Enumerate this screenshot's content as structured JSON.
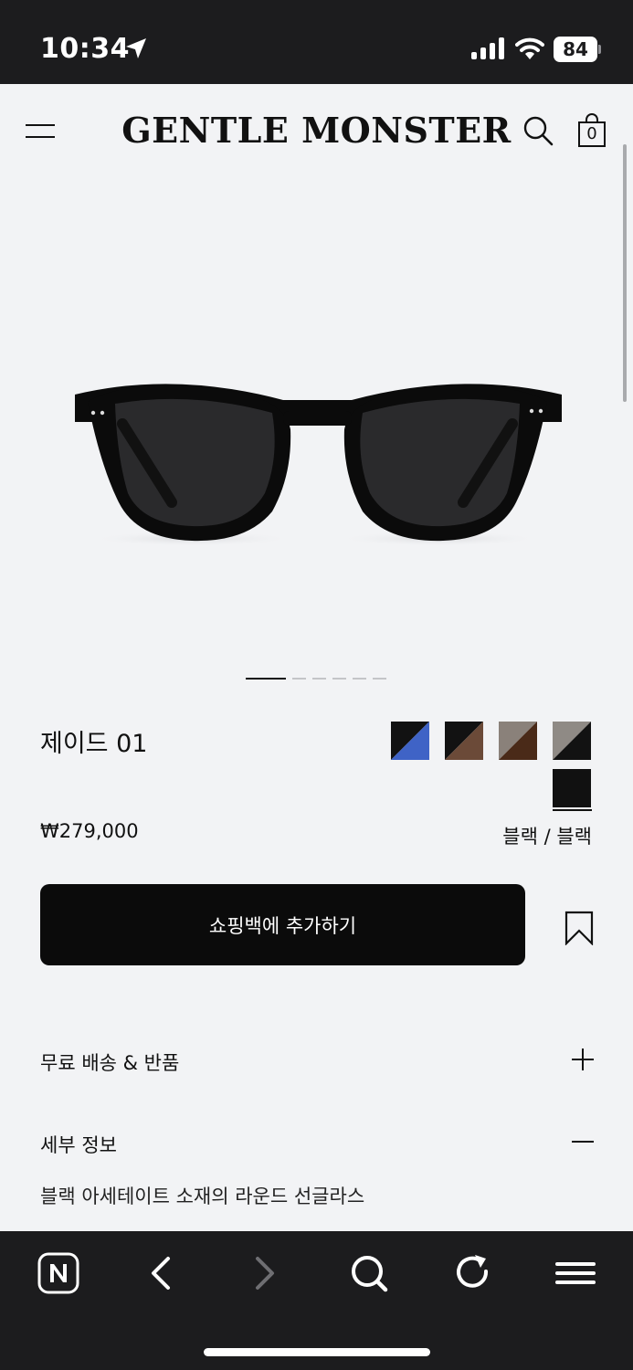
{
  "status_bar": {
    "time": "10:34",
    "battery": "84"
  },
  "header": {
    "brand": "GENTLE MONSTER",
    "bag_count": "0"
  },
  "product": {
    "name": "제이드 01",
    "price": "₩279,000",
    "selected_color": "블랙 / 블랙",
    "carousel": {
      "total": 6,
      "active": 1
    },
    "swatches": [
      {
        "name": "black-blue",
        "colors": [
          "#121212",
          "#3f63c6"
        ]
      },
      {
        "name": "black-brown",
        "colors": [
          "#121212",
          "#6b4a38"
        ]
      },
      {
        "name": "grey-brown",
        "colors": [
          "#8a817a",
          "#4a2a18"
        ]
      },
      {
        "name": "grey-black",
        "colors": [
          "#8f8a85",
          "#121212"
        ]
      },
      {
        "name": "black-black",
        "colors": [
          "#111111",
          "#111111"
        ],
        "selected": true
      }
    ]
  },
  "actions": {
    "add_to_bag": "쇼핑백에 추가하기"
  },
  "accordion": {
    "shipping_label": "무료 배송 & 반품",
    "details_label": "세부 정보",
    "details_text": "블랙 아세테이트 소재의 라운드 선글라스"
  },
  "colors": {
    "status_bar_bg": "#1c1c1e",
    "page_bg": "#f2f3f5",
    "button_bg": "#0b0b0b"
  }
}
